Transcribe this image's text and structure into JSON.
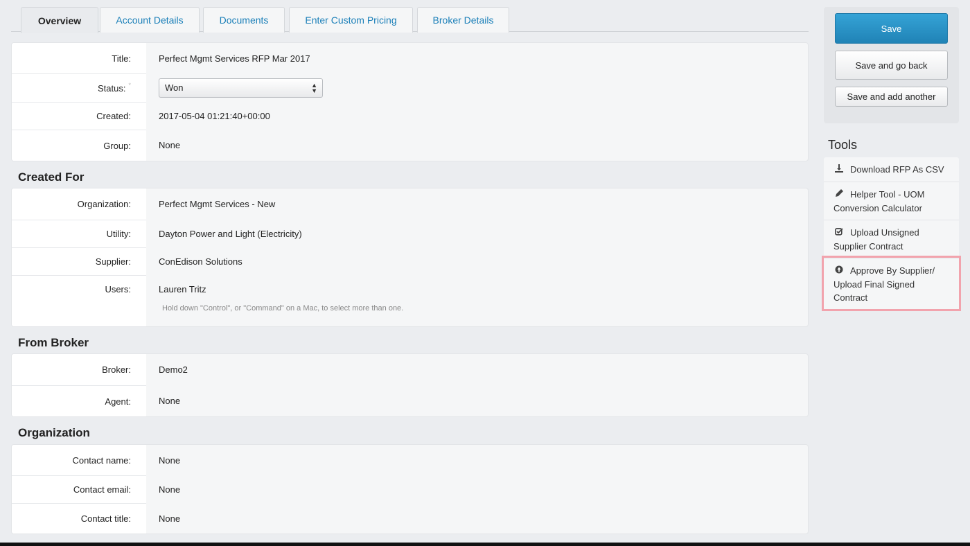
{
  "tabs": [
    {
      "label": "Overview",
      "active": true
    },
    {
      "label": "Account Details"
    },
    {
      "label": "Documents"
    },
    {
      "label": "Enter Custom Pricing"
    },
    {
      "label": "Broker Details"
    }
  ],
  "general": {
    "title_label": "Title:",
    "title_value": "Perfect Mgmt Services RFP Mar 2017",
    "status_label": "Status:",
    "status_required": "*",
    "status_value": "Won",
    "created_label": "Created:",
    "created_value": "2017-05-04 01:21:40+00:00",
    "group_label": "Group:",
    "group_value": "None"
  },
  "created_for": {
    "heading": "Created For",
    "organization_label": "Organization:",
    "organization_value": "Perfect Mgmt Services - New",
    "utility_label": "Utility:",
    "utility_value": "Dayton Power and Light (Electricity)",
    "supplier_label": "Supplier:",
    "supplier_value": "ConEdison Solutions",
    "users_label": "Users:",
    "users_value": "Lauren Tritz",
    "users_help": "Hold down \"Control\", or \"Command\" on a Mac, to select more than one."
  },
  "from_broker": {
    "heading": "From Broker",
    "broker_label": "Broker:",
    "broker_value": "Demo2",
    "agent_label": "Agent:",
    "agent_value": "None"
  },
  "organization": {
    "heading": "Organization",
    "contact_name_label": "Contact name:",
    "contact_name_value": "None",
    "contact_email_label": "Contact email:",
    "contact_email_value": "None",
    "contact_title_label": "Contact title:",
    "contact_title_value": "None"
  },
  "actions": {
    "save": "Save",
    "save_go_back": "Save and go back",
    "save_add_another": "Save and add another"
  },
  "tools": {
    "heading": "Tools",
    "items": [
      {
        "label": "Download RFP As CSV",
        "icon": "download-icon"
      },
      {
        "label": "Helper Tool - UOM Conversion Calculator",
        "icon": "pencil-icon"
      },
      {
        "label": "Upload Unsigned Supplier Contract",
        "icon": "checkbox-icon"
      },
      {
        "label": "Approve By Supplier/ Upload Final Signed Contract",
        "icon": "upload-circle-icon",
        "highlighted": true
      }
    ]
  },
  "colors": {
    "accent": "#2a93c8",
    "highlight_border": "#f2a3ad",
    "link": "#1a7fb8"
  }
}
